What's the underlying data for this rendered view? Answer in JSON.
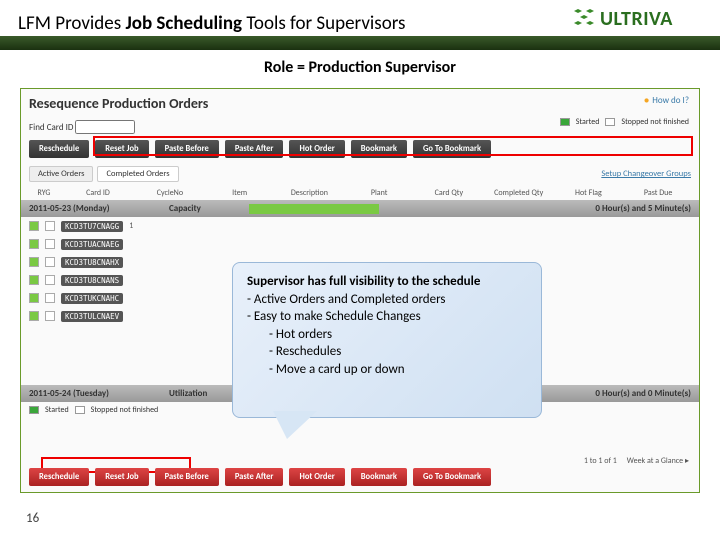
{
  "header": {
    "title_a": "LFM Provides ",
    "title_b": "Job Scheduling",
    "title_c": " Tools for Supervisors",
    "logo": "ULTRIVA"
  },
  "subtitle": "Role = Production Supervisor",
  "ss": {
    "title": "Resequence Production Orders",
    "how": "How do I?",
    "find_label": "Find Card ID",
    "legend_started": "Started",
    "legend_stopped": "Stopped not finished",
    "buttons": [
      "Reschedule",
      "Reset Job",
      "Paste Before",
      "Paste After",
      "Hot Order",
      "Bookmark",
      "Go To Bookmark"
    ],
    "tabs": [
      "Active Orders",
      "Completed Orders"
    ],
    "setup_link": "Setup Changeover Groups",
    "th": [
      "RYG",
      "Card ID",
      "CycleNo",
      "Item",
      "Description",
      "Plant",
      "Card Qty",
      "Completed Qty",
      "Hot Flag",
      "Past Due"
    ],
    "day1": {
      "label": "2011-05-23 (Monday)",
      "cap": "Capacity",
      "pct": "40%",
      "hrs": "0 Hour(s) and 5 Minute(s)"
    },
    "orders": [
      {
        "id": "KCD3TU7CNAGG",
        "n": "1"
      },
      {
        "id": "KCD3TUACNAEG",
        "n": ""
      },
      {
        "id": "KCD3TU8CNAHX",
        "n": ""
      },
      {
        "id": "KCD3TU8CNANS",
        "n": ""
      },
      {
        "id": "KCD3TUKCNAHC",
        "n": ""
      },
      {
        "id": "KCD3TULCNAEV",
        "n": ""
      }
    ],
    "day2": {
      "label": "2011-05-24 (Tuesday)",
      "cap": "Utilization",
      "hrs": "0 Hour(s) and 0 Minute(s)"
    },
    "bottom_legend_started": "Started",
    "bottom_legend_stopped": "Stopped not finished",
    "pager_a": "1 to 1 of 1",
    "pager_b": "Week at a Glance ▸",
    "buttons2": [
      "Reschedule",
      "Reset Job",
      "Paste Before",
      "Paste After",
      "Hot Order",
      "Bookmark",
      "Go To Bookmark"
    ]
  },
  "callout": {
    "line1": "Supervisor has full visibility to the schedule",
    "line2": "-  Active Orders and Completed orders",
    "line3": "-  Easy to make Schedule Changes",
    "line4": "-  Hot orders",
    "line5": "-  Reschedules",
    "line6": "-  Move a card up or down"
  },
  "page_num": "16"
}
